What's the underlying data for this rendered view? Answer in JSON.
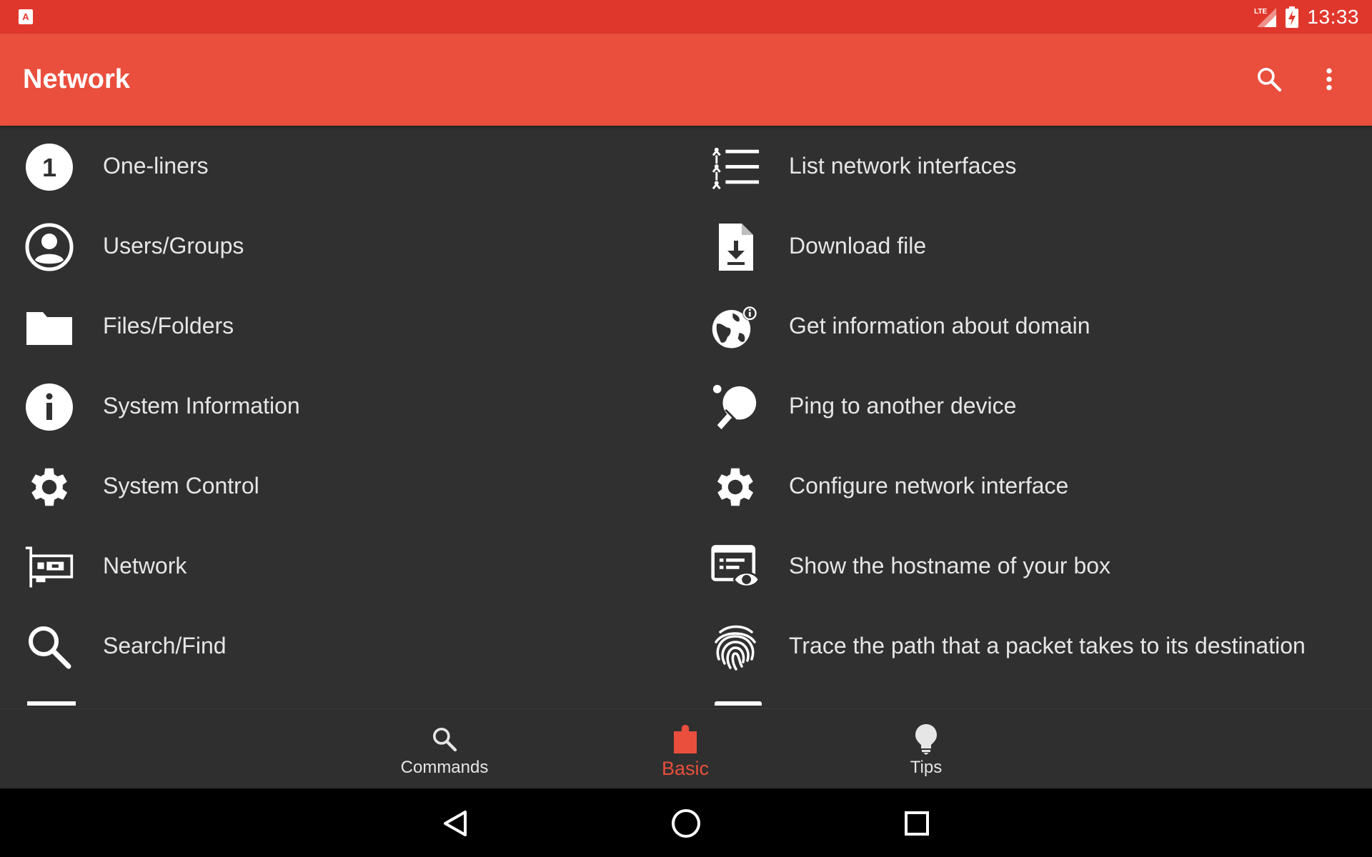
{
  "status_bar": {
    "app_icon": "a-letter-icon",
    "network_label": "LTE",
    "time": "13:33"
  },
  "app_bar": {
    "title": "Network",
    "actions": [
      "search-icon",
      "more-vert-icon"
    ]
  },
  "categories": [
    {
      "label": "One-liners",
      "icon": "number-one-icon"
    },
    {
      "label": "Users/Groups",
      "icon": "account-circle-icon"
    },
    {
      "label": "Files/Folders",
      "icon": "folder-icon"
    },
    {
      "label": "System Information",
      "icon": "info-icon"
    },
    {
      "label": "System Control",
      "icon": "gear-icon"
    },
    {
      "label": "Network",
      "icon": "network-card-icon"
    },
    {
      "label": "Search/Find",
      "icon": "search-icon"
    }
  ],
  "commands": [
    {
      "label": "List network interfaces",
      "icon": "tree-list-icon"
    },
    {
      "label": "Download file",
      "icon": "file-download-icon"
    },
    {
      "label": "Get information about domain",
      "icon": "globe-info-icon"
    },
    {
      "label": "Ping to another device",
      "icon": "ping-pong-icon"
    },
    {
      "label": "Configure network interface",
      "icon": "gear-icon"
    },
    {
      "label": "Show the hostname of your box",
      "icon": "card-eye-icon"
    },
    {
      "label": "Trace the path that a packet takes to its destination",
      "icon": "fingerprint-icon"
    }
  ],
  "bottom_nav": {
    "items": [
      {
        "label": "Commands",
        "icon": "search-icon",
        "active": false
      },
      {
        "label": "Basic",
        "icon": "puzzle-icon",
        "active": true
      },
      {
        "label": "Tips",
        "icon": "lightbulb-icon",
        "active": false
      }
    ]
  },
  "colors": {
    "status_bar": "#e0372c",
    "app_bar": "#ea4e3d",
    "background": "#303030",
    "accent": "#ea4e3d",
    "text": "#e6e6e6"
  },
  "system_nav": [
    "back-icon",
    "home-icon",
    "recents-icon"
  ]
}
